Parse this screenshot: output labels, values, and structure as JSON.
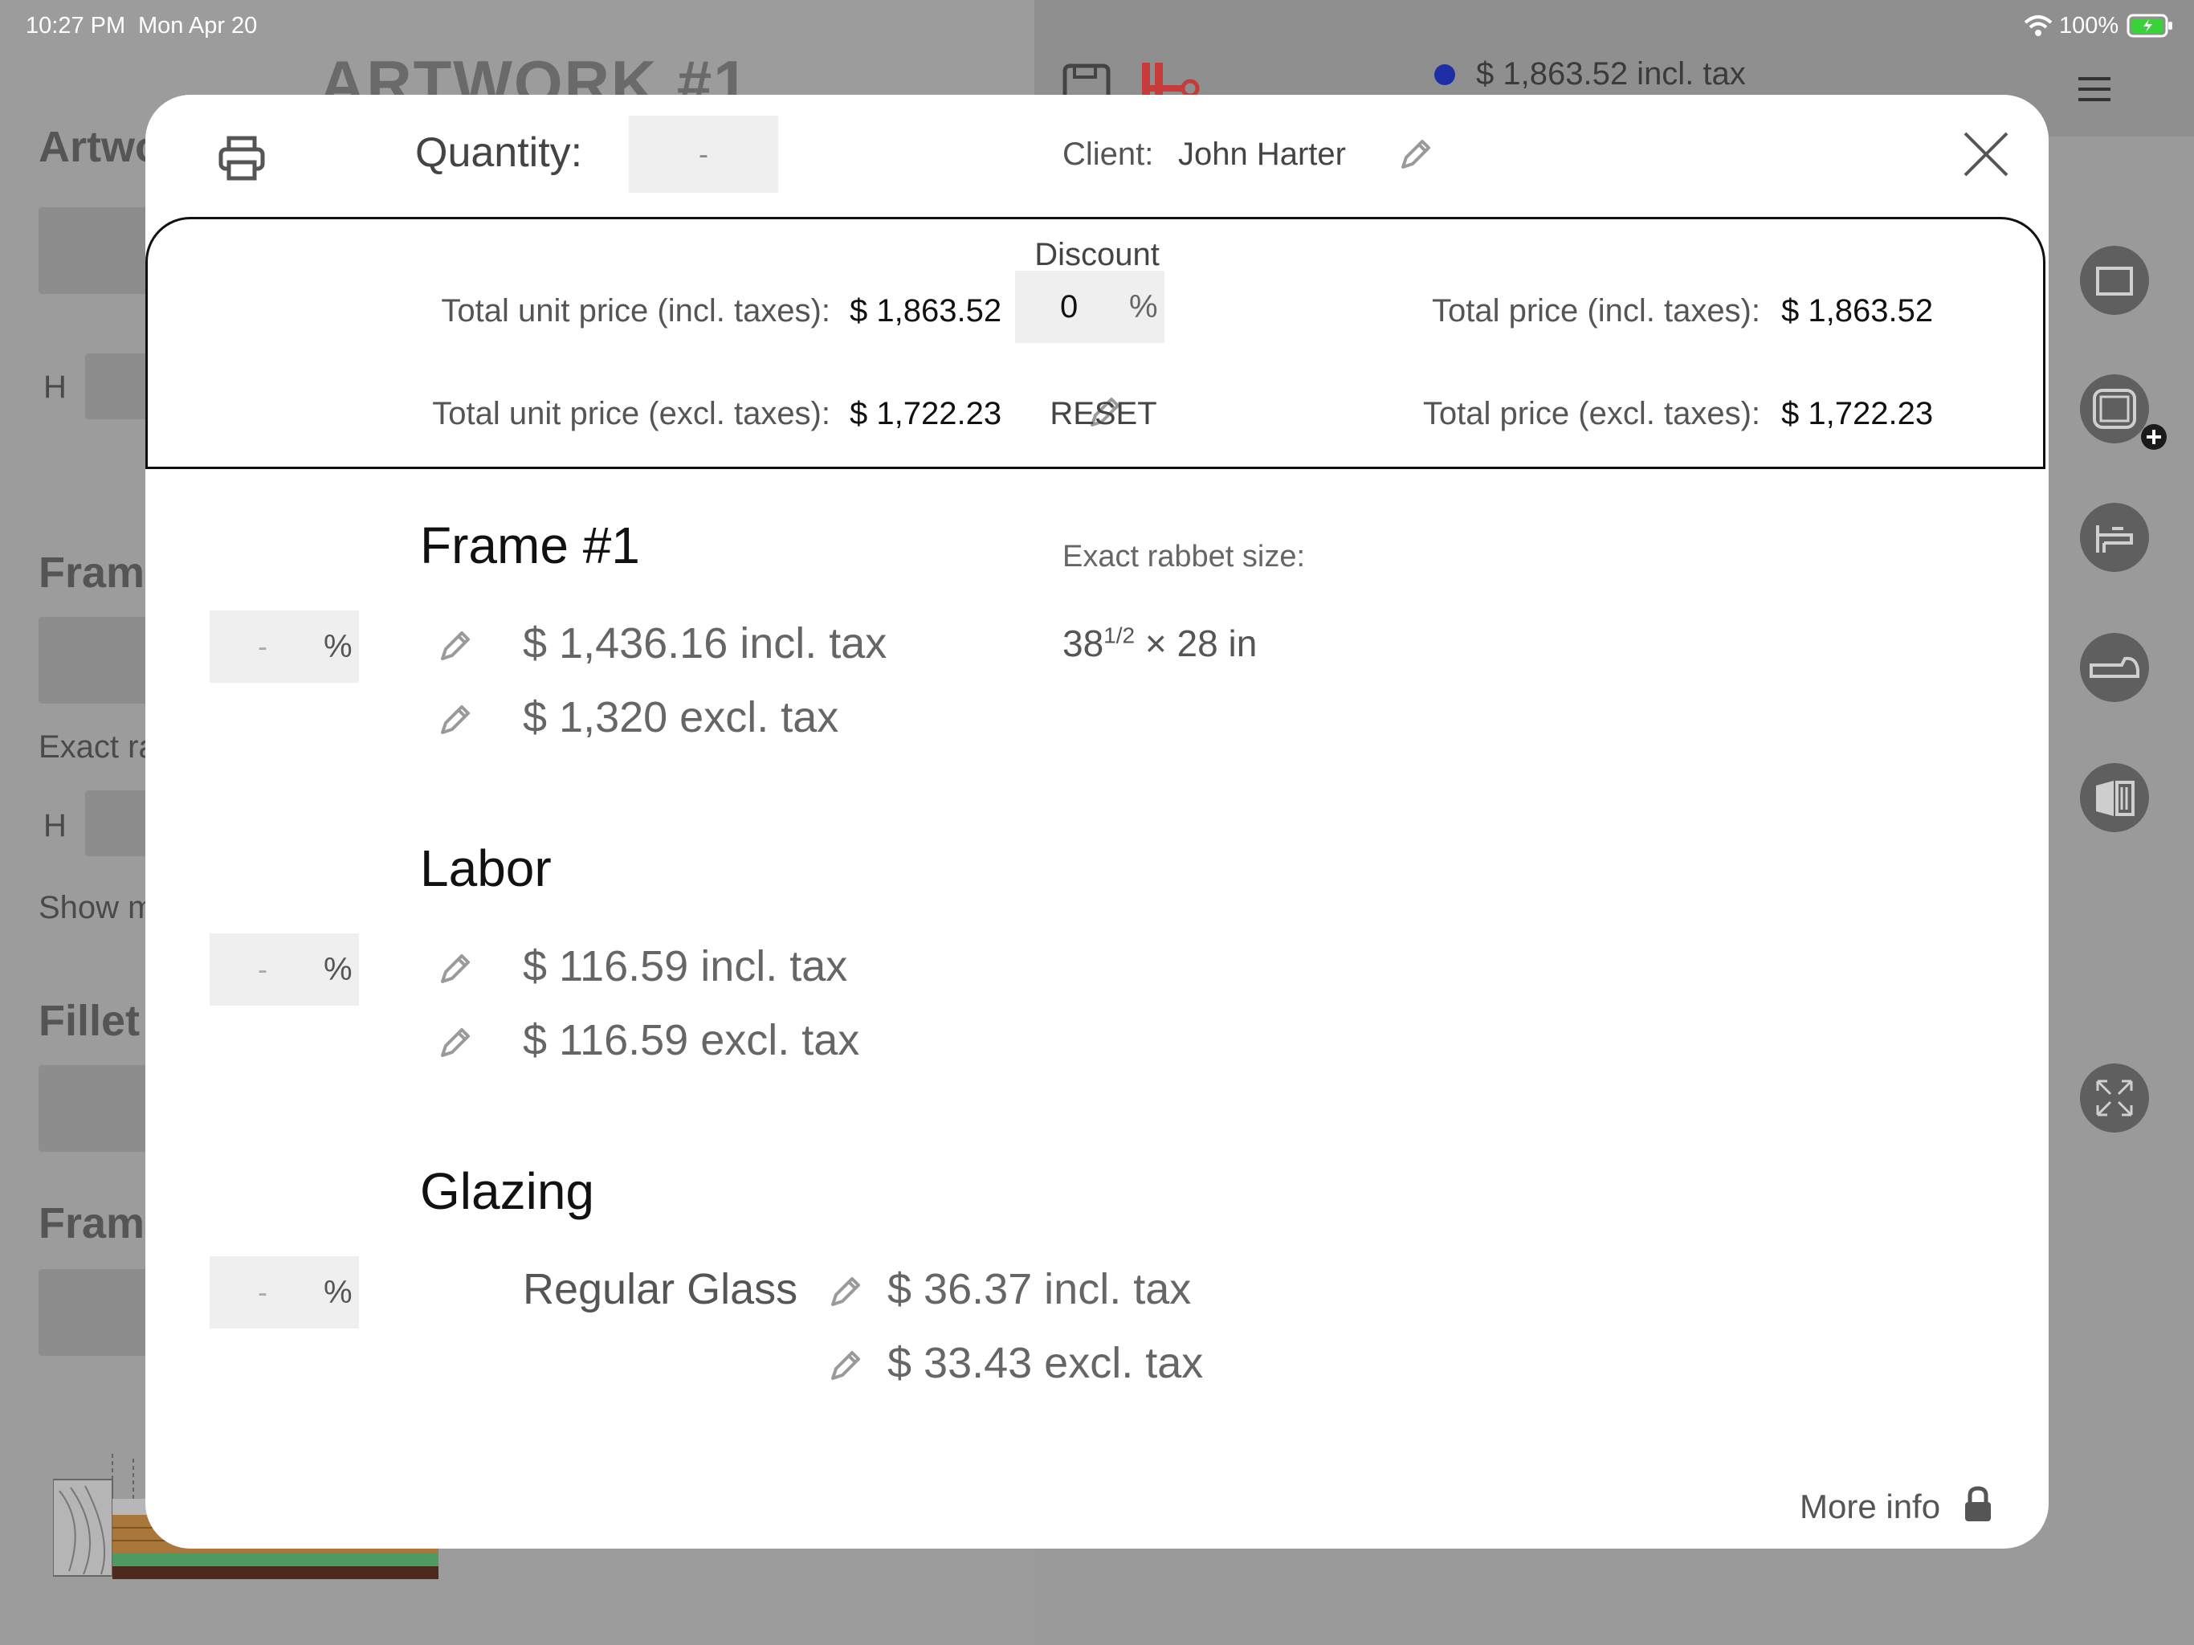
{
  "status_bar": {
    "time": "10:27 PM",
    "date": "Mon Apr 20",
    "battery": "100%"
  },
  "background": {
    "title": "ARTWORK #1",
    "total": "$ 1,863.52 incl. tax",
    "left_labels": {
      "artwork": "Artwork",
      "h1": "H",
      "frame": "Frame",
      "exact": "Exact rabbet",
      "h2": "H",
      "show": "Show more",
      "fillet": "Fillet",
      "framing": "Framing"
    },
    "accent_dot": "#1e2fa6"
  },
  "modal": {
    "quantity_label": "Quantity:",
    "quantity_value": "-",
    "client_label": "Client:",
    "client_name": "John Harter",
    "summary": {
      "discount_label": "Discount",
      "discount_value": "0",
      "discount_unit": "%",
      "reset_label": "RESET",
      "unit_incl_label": "Total unit price (incl. taxes):",
      "unit_incl_value": "$ 1,863.52",
      "unit_excl_label": "Total unit price (excl. taxes):",
      "unit_excl_value": "$ 1,722.23",
      "total_incl_label": "Total price (incl. taxes):",
      "total_incl_value": "$ 1,863.52",
      "total_excl_label": "Total price (excl. taxes):",
      "total_excl_value": "$ 1,722.23"
    },
    "frame": {
      "title": "Frame  #1",
      "percent_value": "-",
      "percent_unit": "%",
      "incl": "$ 1,436.16 incl. tax",
      "excl": "$ 1,320 excl. tax",
      "rabbet_label": "Exact rabbet size:",
      "rabbet_whole": "38",
      "rabbet_frac": "1/2",
      "rabbet_rest": " × 28 in"
    },
    "labor": {
      "title": "Labor",
      "percent_value": "-",
      "percent_unit": "%",
      "incl": "$ 116.59 incl. tax",
      "excl": "$ 116.59 excl. tax"
    },
    "glazing": {
      "title": "Glazing",
      "percent_value": "-",
      "percent_unit": "%",
      "item": "Regular Glass",
      "incl": "$ 36.37 incl. tax",
      "excl": "$ 33.43 excl. tax"
    },
    "more_info": "More info"
  }
}
